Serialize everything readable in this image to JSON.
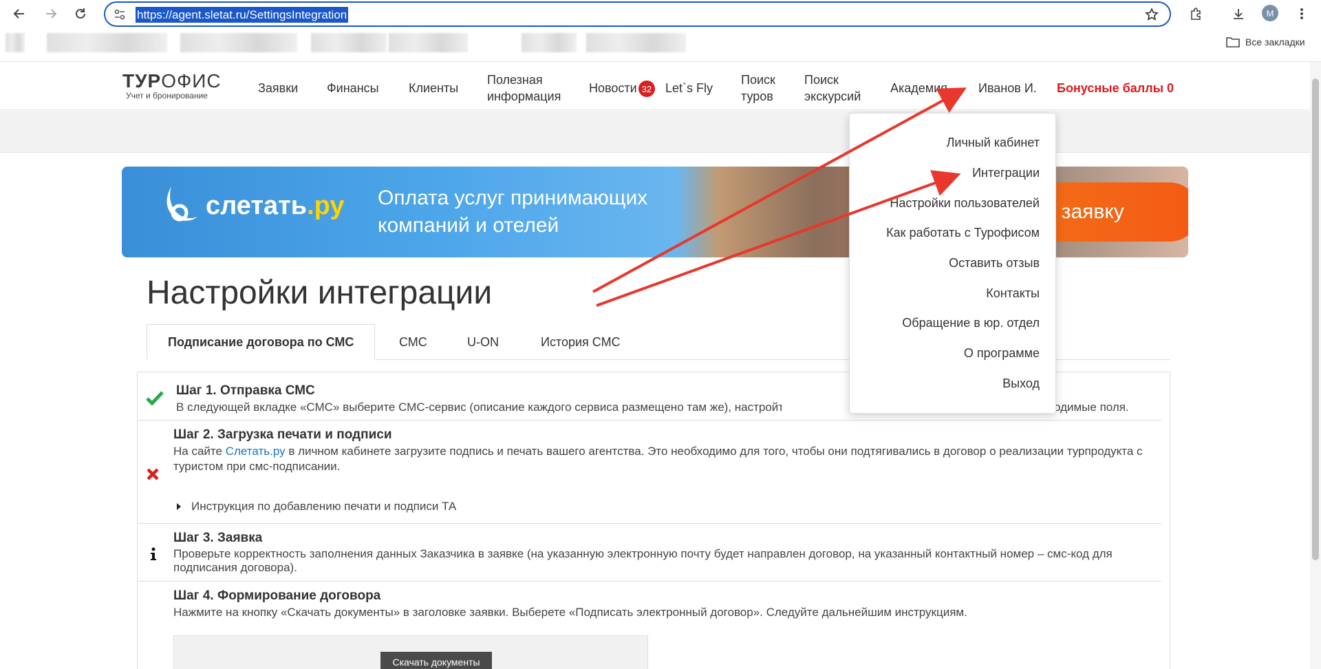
{
  "browser": {
    "url": "https://agent.sletat.ru/SettingsIntegration",
    "avatar_letter": "M",
    "all_bookmarks": "Все закладки"
  },
  "header": {
    "logo_bold": "ТУР",
    "logo_light": "ОФИС",
    "logo_sub": "Учет и бронирование",
    "nav": [
      "Заявки",
      "Финансы",
      "Клиенты",
      "Полезная информация",
      "Новости",
      "Let`s Fly",
      "Поиск туров",
      "Поиск экскурсий",
      "Академия",
      "Иванов И."
    ],
    "news_badge": "32",
    "bonus": "Бонусные баллы 0"
  },
  "banner": {
    "logo": "слетать",
    "logo_ru": ".ру",
    "text": "Оплата услуг принимающих компаний и отелей",
    "button_visible": "ть заявку"
  },
  "page": {
    "title": "Настройки интеграции",
    "tabs": [
      "Подписание договора по СМС",
      "СМС",
      "U-ON",
      "История СМС"
    ]
  },
  "steps": [
    {
      "title": "Шаг 1. Отправка СМС",
      "text": "В следующей вкладке «СМС» выберите СМС-сервис (описание каждого сервиса размещено там же), настройте с н",
      "text_tail": "одимые поля.",
      "status": "done"
    },
    {
      "title": "Шаг 2. Загрузка печати и подписи",
      "text_before": "На сайте ",
      "link": "Слетать.ру",
      "text_after": " в личном кабинете загрузите подпись и печать вашего агентства. Это необходимо для того, чтобы они подтягивались в договор о реализации турпродукта с туристом при смс-подписании.",
      "details": "Инструкция по добавлению печати и подписи ТА",
      "status": "error"
    },
    {
      "title": "Шаг 3. Заявка",
      "text": "Проверьте корректность заполнения данных Заказчика в заявке (на указанную электронную почту будет направлен договор, на указанный контактный номер – смс-код для подписания договора).",
      "status": "info"
    },
    {
      "title": "Шаг 4. Формирование договора",
      "text": "Нажмите на кнопку «Скачать документы» в заголовке заявки. Выберете «Подписать электронный договор». Следуйте дальнейшим инструкциям.",
      "image_button": "Скачать документы"
    }
  ],
  "user_menu": [
    "Личный кабинет",
    "Интеграции",
    "Настройки пользователей",
    "Как работать с Турофисом",
    "Оставить отзыв",
    "Контакты",
    "Обращение в юр. отдел",
    "О программе",
    "Выход"
  ],
  "colors": {
    "accent_blue": "#1a57c9",
    "bonus_red": "#e0191d",
    "arrow_red": "#e8372c",
    "check_green": "#2aa84a"
  }
}
